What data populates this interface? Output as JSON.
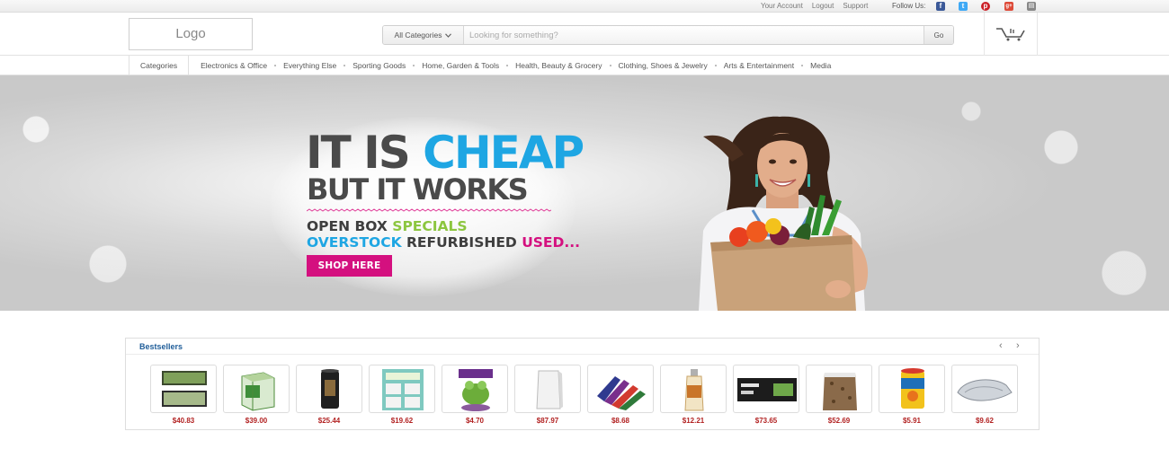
{
  "top_links": [
    "Your Account",
    "Logout",
    "Support"
  ],
  "follow_label": "Follow Us:",
  "social": [
    {
      "name": "facebook-icon",
      "glyph": "f",
      "color": "#3b5998"
    },
    {
      "name": "twitter-icon",
      "glyph": "t",
      "color": "#3fa9f5"
    },
    {
      "name": "pinterest-icon",
      "glyph": "p",
      "color": "#cb2027"
    },
    {
      "name": "googleplus-icon",
      "glyph": "g+",
      "color": "#dd4b39"
    },
    {
      "name": "rss-icon",
      "glyph": "▤",
      "color": "#888888"
    }
  ],
  "header": {
    "logo": "Logo",
    "category_select": "All Categories",
    "search_placeholder": "Looking for something?",
    "go_label": "Go"
  },
  "nav": {
    "categories_label": "Categories",
    "items": [
      "Electronics & Office",
      "Everything Else",
      "Sporting Goods",
      "Home, Garden & Tools",
      "Health, Beauty & Grocery",
      "Clothing, Shoes & Jewelry",
      "Arts & Entertainment",
      "Media"
    ]
  },
  "hero": {
    "line1_a": "IT IS ",
    "line1_b": "CHEAP",
    "line2": "BUT IT WORKS",
    "promo_open_box": "OPEN BOX ",
    "promo_specials": "SPECIALS",
    "promo_overstock": "OVERSTOCK ",
    "promo_refurbished": "REFURBISHED ",
    "promo_used": "USED...",
    "cta": "SHOP HERE"
  },
  "bestsellers": {
    "title": "Bestsellers",
    "prev": "‹",
    "next": "›",
    "products": [
      {
        "price": "$40.83",
        "kind": "terrarium"
      },
      {
        "price": "$39.00",
        "kind": "box-green"
      },
      {
        "price": "$25.44",
        "kind": "black-cylinder"
      },
      {
        "price": "$19.62",
        "kind": "teal-box"
      },
      {
        "price": "$4.70",
        "kind": "frog-figure"
      },
      {
        "price": "$87.97",
        "kind": "white-pedestal"
      },
      {
        "price": "$8.68",
        "kind": "colorful-fan"
      },
      {
        "price": "$12.21",
        "kind": "bottle"
      },
      {
        "price": "$73.65",
        "kind": "black-kit"
      },
      {
        "price": "$52.69",
        "kind": "bag-bits"
      },
      {
        "price": "$5.91",
        "kind": "food-can"
      },
      {
        "price": "$9.62",
        "kind": "silver-scoop"
      }
    ]
  },
  "colors": {
    "accent_blue": "#1ea6e3",
    "accent_pink": "#d4107f",
    "accent_green": "#8cc63f",
    "price_red": "#b22222",
    "title_blue": "#1f5d99"
  }
}
